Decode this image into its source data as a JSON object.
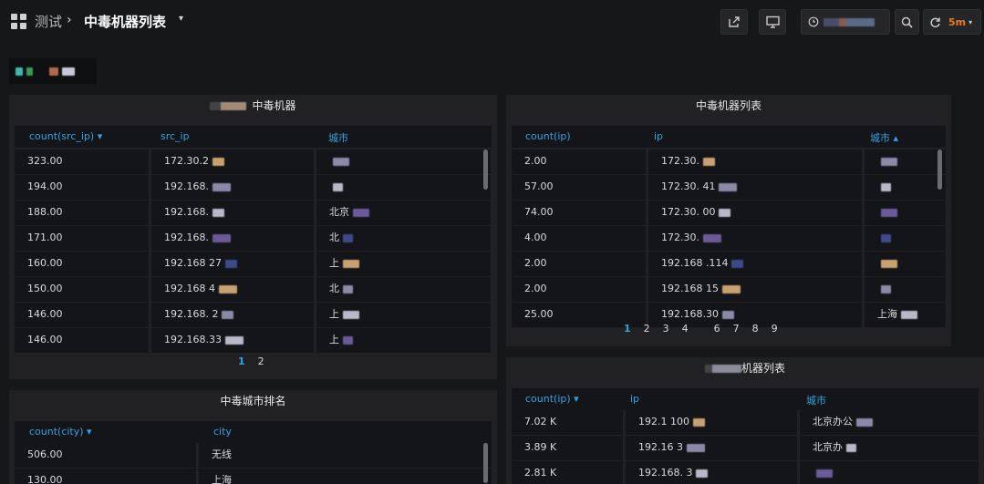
{
  "header": {
    "breadcrumb_folder": "测试",
    "breadcrumb_separator": "›",
    "dashboard_title": "中毒机器列表",
    "dashboard_caret": "▾",
    "time_icon": "clock-icon",
    "refresh_interval": "5m",
    "refresh_caret": "▾"
  },
  "panels": {
    "top_left": {
      "title": "中毒机器",
      "columns": [
        "count(src_ip) ▾",
        "src_ip",
        "城市"
      ],
      "rows": [
        [
          "323.00",
          "172.30.2",
          ""
        ],
        [
          "194.00",
          "192.168.",
          ""
        ],
        [
          "188.00",
          "192.168.",
          "北京"
        ],
        [
          "171.00",
          "192.168.",
          "北"
        ],
        [
          "160.00",
          "192.168   27",
          "上"
        ],
        [
          "150.00",
          "192.168   4",
          "北"
        ],
        [
          "146.00",
          "192.168.   2",
          "上"
        ],
        [
          "146.00",
          "192.168.33",
          "上"
        ]
      ],
      "pages": [
        "1",
        "2"
      ]
    },
    "top_right": {
      "title": "中毒机器列表",
      "columns": [
        "count(ip)",
        "ip",
        "城市 ▴"
      ],
      "rows": [
        [
          "2.00",
          "172.30.",
          ""
        ],
        [
          "57.00",
          "172.30.   41",
          ""
        ],
        [
          "74.00",
          "172.30.   00",
          ""
        ],
        [
          "4.00",
          "172.30.",
          ""
        ],
        [
          "2.00",
          "192.168   .114",
          ""
        ],
        [
          "2.00",
          "192.168   15",
          ""
        ],
        [
          "25.00",
          "192.168.30",
          "上海"
        ]
      ],
      "pages": [
        "1",
        "2",
        "3",
        "4",
        "",
        "6",
        "7",
        "8",
        "9"
      ]
    },
    "bottom_left": {
      "title": "中毒城市排名",
      "columns": [
        "count(city) ▾",
        "city"
      ],
      "rows": [
        [
          "506.00",
          "无线"
        ],
        [
          "130.00",
          "上海"
        ]
      ]
    },
    "bottom_right": {
      "title": "机器列表",
      "columns": [
        "count(ip) ▾",
        "ip",
        "城市"
      ],
      "rows": [
        [
          "7.02 K",
          "192.1   100",
          "北京办公"
        ],
        [
          "3.89 K",
          "192.16   3",
          "北京办"
        ],
        [
          "2.81 K",
          "192.168.   3",
          ""
        ]
      ]
    }
  },
  "colors": {
    "background": "#161719",
    "panel": "#212124",
    "cell": "#141518",
    "header_link": "#33a2e5",
    "refresh_accent": "#eb7b18"
  }
}
